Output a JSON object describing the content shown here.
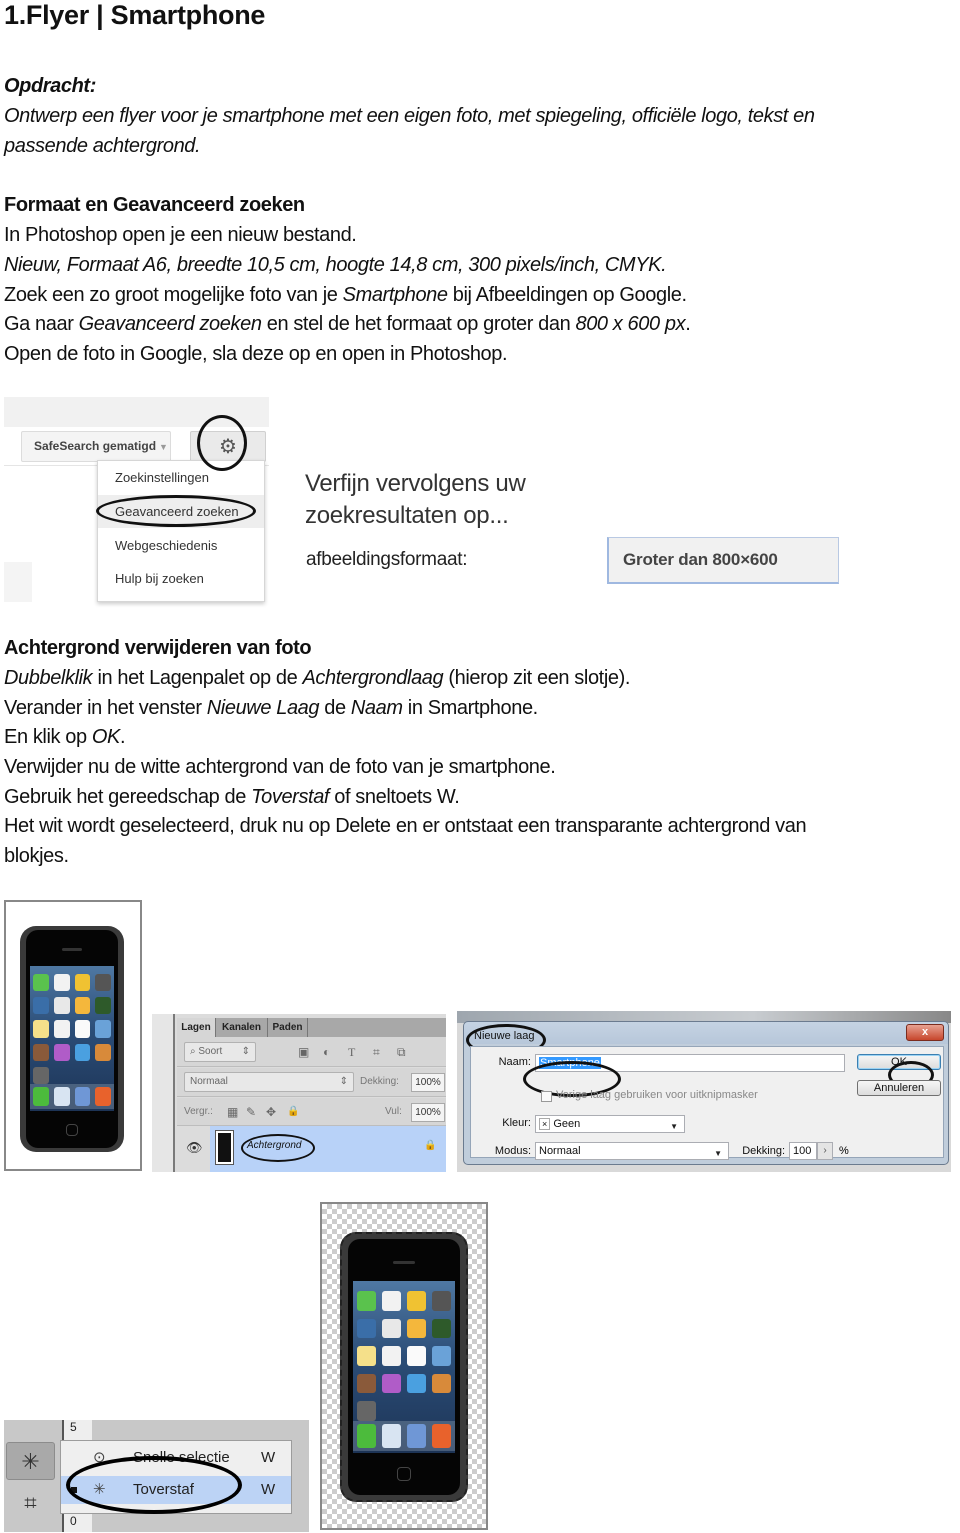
{
  "document": {
    "title": "1.Flyer | Smartphone",
    "assignment": {
      "heading": "Opdracht:",
      "text_line1": "Ontwerp een flyer voor je smartphone met een eigen foto, met spiegeling, officiële logo, tekst en",
      "text_line2": "passende achtergrond."
    },
    "section1": {
      "heading": "Formaat en Geavanceerd zoeken",
      "line1": "In Photoshop open je een nieuw bestand.",
      "line2": "Nieuw, Formaat A6, breedte 10,5 cm, hoogte 14,8 cm, 300 pixels/inch, CMYK.",
      "line3_a": "Zoek een zo groot mogelijke foto van je ",
      "line3_b": "Smartphone",
      "line3_c": " bij Afbeeldingen op Google.",
      "line4_a": "Ga naar ",
      "line4_b": "Geavanceerd zoeken",
      "line4_c": " en stel de het formaat op groter dan ",
      "line4_d": "800 x 600 px",
      "line4_e": ".",
      "line5": "Open de foto in Google, sla deze op en open in Photoshop."
    },
    "section2": {
      "heading": "Achtergrond verwijderen van foto",
      "line1_a": "Dubbelklik",
      "line1_b": " in het Lagenpalet op de ",
      "line1_c": "Achtergrondlaag",
      "line1_d": " (hierop zit een slotje).",
      "line2_a": "Verander in het venster ",
      "line2_b": "Nieuwe Laag",
      "line2_c": " de ",
      "line2_d": "Naam",
      "line2_e": " in Smartphone.",
      "line3_a": "En klik op ",
      "line3_b": "OK",
      "line3_c": ".",
      "line4": "Verwijder nu de witte achtergrond van de foto van je smartphone.",
      "line5_a": "Gebruik het gereedschap de ",
      "line5_b": "Toverstaf",
      "line5_c": " of sneltoets W.",
      "line6": "Het wit wordt geselecteerd, druk nu op Delete en er ontstaat een transparante achtergrond van",
      "line7": "blokjes."
    }
  },
  "google_screenshot": {
    "safesearch_label": "SafeSearch gematigd",
    "safesearch_caret": "▼",
    "gear_icon": "⚙",
    "menu_items": [
      "Zoekinstellingen",
      "Geavanceerd zoeken",
      "Webgeschiedenis",
      "Hulp bij zoeken"
    ],
    "highlighted_item": "Geavanceerd zoeken",
    "refine_line1": "Verfijn vervolgens uw",
    "refine_line2": "zoekresultaten op...",
    "size_label": "afbeeldingsformaat:",
    "size_value": "Groter dan 800×600"
  },
  "layers_panel": {
    "tabs": [
      "Lagen",
      "Kanalen",
      "Paden"
    ],
    "active_tab": "Lagen",
    "filter_label": "Soort",
    "filter_icon": "⌕",
    "filter_arrows": "⇕",
    "filter_icons": [
      "▣",
      "◐",
      "T",
      "⌗",
      "⧉"
    ],
    "blend_mode": "Normaal",
    "opacity_label": "Dekking:",
    "opacity_value": "100%",
    "lock_label": "Vergr.:",
    "lock_icons": [
      "▦",
      "✎",
      "✥",
      "🔒"
    ],
    "fill_label": "Vul:",
    "fill_value": "100%",
    "layer_name": "Achtergrond",
    "eye_icon": "👁",
    "lock_icon": "🔒"
  },
  "new_layer_dialog": {
    "title": "Nieuwe laag",
    "close_label": "x",
    "naam_label": "Naam:",
    "naam_value": "Smartphone",
    "clip_label": "Vorige laag gebruiken voor uitknipmasker",
    "kleur_label": "Kleur:",
    "kleur_icon": "×",
    "kleur_value": "Geen",
    "modus_label": "Modus:",
    "modus_value": "Normaal",
    "dekking_label": "Dekking:",
    "dekking_value": "100",
    "percent": "%",
    "ok_label": "OK",
    "cancel_label": "Annuleren",
    "dropdown_arrow": "▼",
    "stepper_arrow": "›"
  },
  "tool_flyout": {
    "items": [
      {
        "label": "Snelle selectie",
        "shortcut": "W",
        "icon": "⊙"
      },
      {
        "label": "Toverstaf",
        "shortcut": "W",
        "icon": "✳"
      }
    ],
    "highlighted_item": "Toverstaf",
    "ruler_numbers": [
      "5",
      "0"
    ],
    "tool_icons": [
      "✳",
      "⌗"
    ]
  },
  "colors": {
    "selection_blue": "#b8d2f8",
    "text_highlight": "#3399ff",
    "close_red": "#c7462c"
  }
}
